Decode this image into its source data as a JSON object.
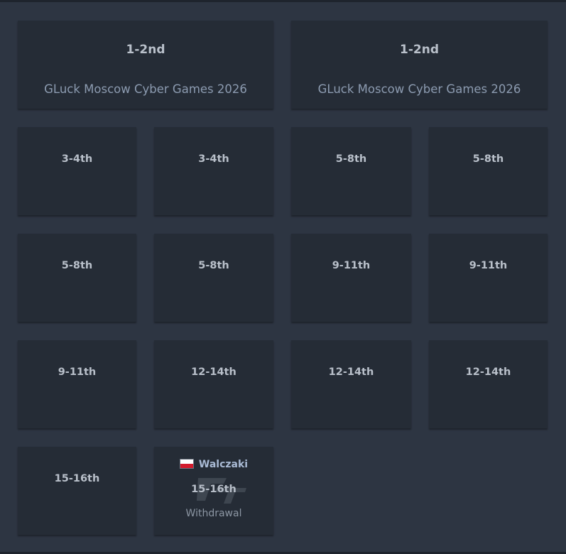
{
  "cards": [
    {
      "place": "1-2nd",
      "event": "GLuck Moscow Cyber Games 2026"
    },
    {
      "place": "1-2nd",
      "event": "GLuck Moscow Cyber Games 2026"
    },
    {
      "place": "3-4th"
    },
    {
      "place": "3-4th"
    },
    {
      "place": "5-8th"
    },
    {
      "place": "5-8th"
    },
    {
      "place": "5-8th"
    },
    {
      "place": "5-8th"
    },
    {
      "place": "9-11th"
    },
    {
      "place": "9-11th"
    },
    {
      "place": "9-11th"
    },
    {
      "place": "12-14th"
    },
    {
      "place": "12-14th"
    },
    {
      "place": "12-14th"
    },
    {
      "place": "15-16th"
    },
    {
      "place": "15-16th",
      "team": "Walczaki",
      "flag_icon": "poland-flag-icon",
      "status": "Withdrawal"
    }
  ],
  "colors": {
    "background": "#2d3542",
    "card": "#252c36",
    "place_text": "#b9c0ca",
    "event_text": "#8c9bb0",
    "team_text": "#a9bad4"
  }
}
